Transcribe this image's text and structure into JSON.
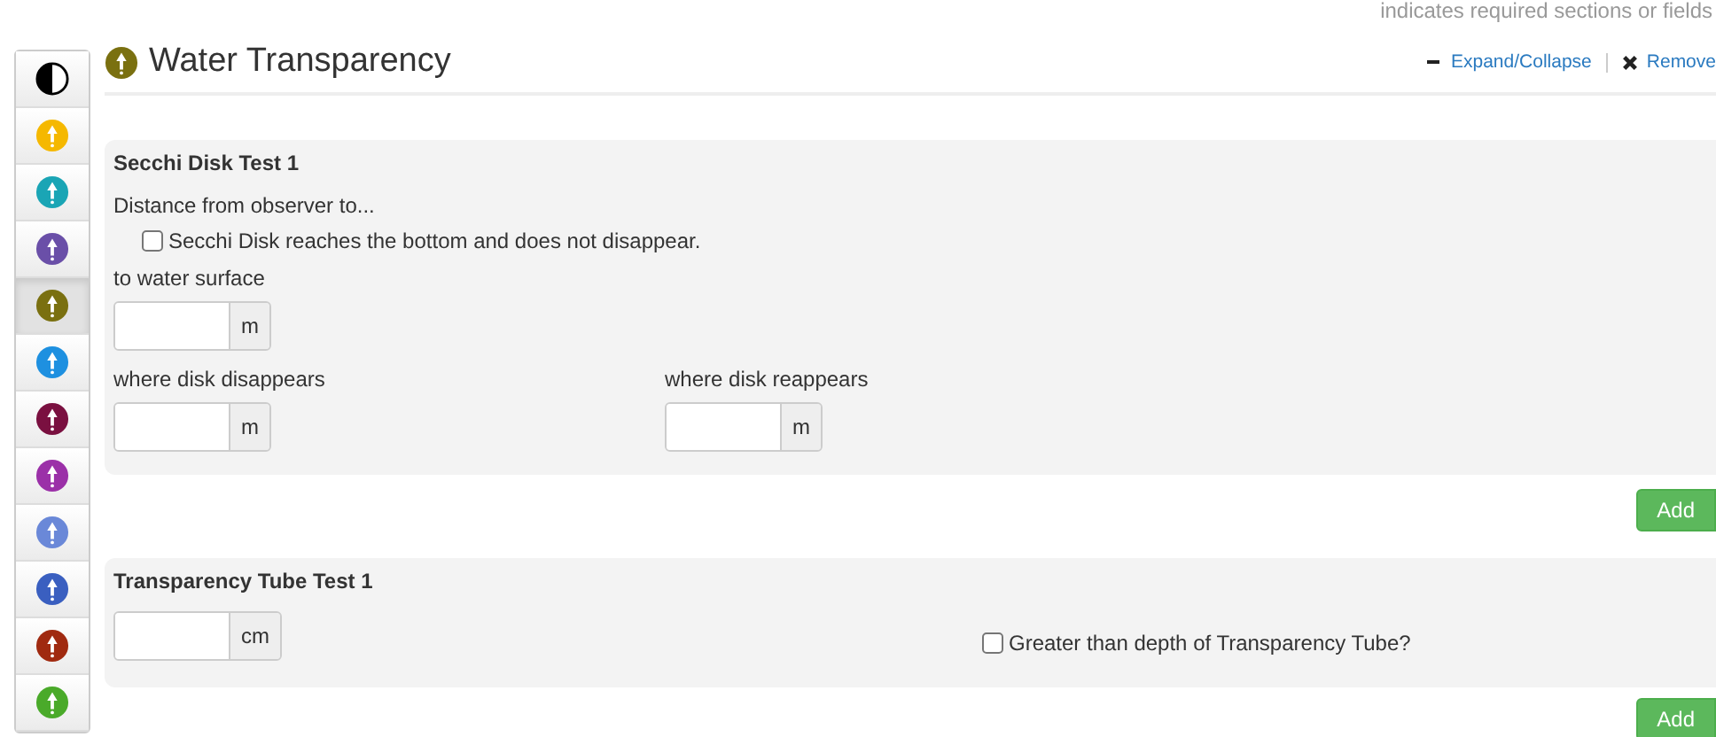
{
  "notice": "indicates required sections or fields",
  "sidebar": {
    "items": [
      {
        "kind": "contrast",
        "color": "#000000",
        "selected": false
      },
      {
        "kind": "badge",
        "color": "#f5b800",
        "selected": false
      },
      {
        "kind": "badge",
        "color": "#1aa5b5",
        "selected": false
      },
      {
        "kind": "badge",
        "color": "#6a4fa8",
        "selected": false
      },
      {
        "kind": "badge",
        "color": "#7a7010",
        "selected": true
      },
      {
        "kind": "badge",
        "color": "#1e90e0",
        "selected": false
      },
      {
        "kind": "badge",
        "color": "#7a1040",
        "selected": false
      },
      {
        "kind": "badge",
        "color": "#9b30a8",
        "selected": false
      },
      {
        "kind": "badge",
        "color": "#6a88d8",
        "selected": false
      },
      {
        "kind": "badge",
        "color": "#3a5fc0",
        "selected": false
      },
      {
        "kind": "badge",
        "color": "#a02a10",
        "selected": false
      },
      {
        "kind": "badge",
        "color": "#4aaa2a",
        "selected": false
      }
    ]
  },
  "section": {
    "title": "Water Transparency",
    "links": [
      "Expand/Collapse",
      "Remove"
    ]
  },
  "panels": [
    {
      "title": "Secchi Disk Test 1",
      "intro": "Distance from observer to...",
      "checkbox": {
        "label": "Secchi Disk reaches the bottom and does not disappear.",
        "checked": false
      },
      "fields": [
        {
          "label": "to water surface",
          "unit": "m"
        }
      ],
      "field_pairs": [
        {
          "label": "where disk disappears",
          "unit": "m"
        },
        {
          "label": "where disk reappears",
          "unit": "m"
        }
      ],
      "add": "Add"
    },
    {
      "title": "Transparency Tube Test 1",
      "fields": [
        {
          "unit": "cm"
        }
      ],
      "checkbox_right": {
        "label": "Greater than depth of Transparency Tube?",
        "checked": false
      },
      "add": "Add"
    }
  ]
}
